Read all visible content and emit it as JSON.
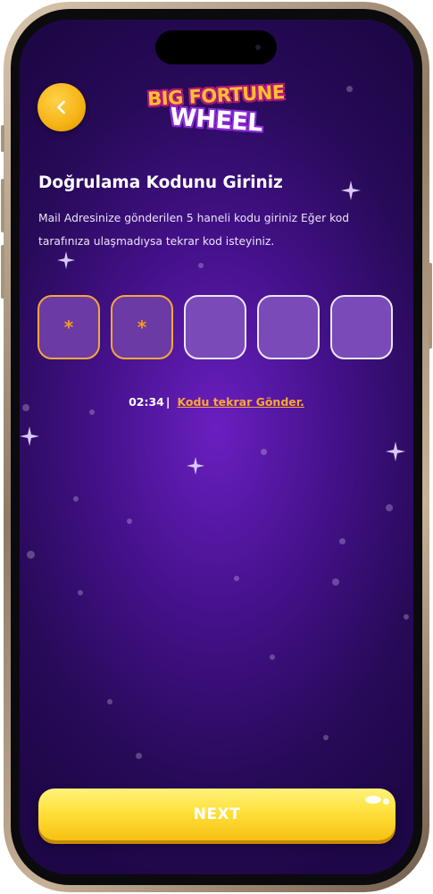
{
  "header": {
    "back_icon": "chevron-left-icon",
    "logo_line1": "BIG FORTUNE",
    "logo_line2": "WHEEL"
  },
  "verification": {
    "title": "Doğrulama Kodunu Giriniz",
    "description_line1": "Mail  Adresinize gönderilen 5 haneli kodu giriniz Eğer kod",
    "description_line2": "tarafınıza ulaşmadıysa tekrar kod isteyiniz.",
    "code_boxes": [
      "*",
      "*",
      "",
      "",
      ""
    ],
    "timer": "02:34",
    "separator": "|",
    "resend_link": "Kodu tekrar Gönder."
  },
  "footer": {
    "next_label": "NEXT"
  },
  "colors": {
    "accent": "#f6b313",
    "background": "#44118a",
    "filled_border": "#f3a83a",
    "link": "#ffa630"
  }
}
